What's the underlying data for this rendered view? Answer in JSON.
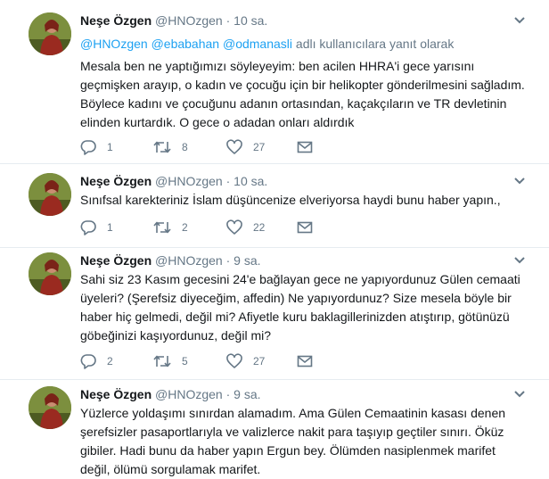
{
  "colors": {
    "link": "#1da1f2",
    "muted": "#657786",
    "text": "#14171a",
    "border": "#e6ecf0"
  },
  "tweets": [
    {
      "name": "Neşe Özgen",
      "handle": "@HNOzgen",
      "dot": "·",
      "time": "10 sa.",
      "reply_mentions": [
        "@HNOzgen",
        "@ebabahan",
        "@odmanasli"
      ],
      "reply_suffix": "adlı kullanıcılara yanıt olarak",
      "text": "Mesala ben ne yaptığımızı söyleyeyim: ben acilen HHRA'i gece yarısını geçmişken arayıp, o kadın ve çocuğu için bir helikopter gönderilmesini sağladım. Böylece kadını ve çocuğunu adanın ortasından, kaçakçıların ve TR devletinin elinden kurtardık. O gece o adadan onları aldırdık",
      "replies": "1",
      "retweets": "8",
      "likes": "27"
    },
    {
      "name": "Neşe Özgen",
      "handle": "@HNOzgen",
      "dot": "·",
      "time": "10 sa.",
      "text": "Sınıfsal karekteriniz İslam düşüncenize elveriyorsa haydi bunu haber yapın.,",
      "replies": "1",
      "retweets": "2",
      "likes": "22"
    },
    {
      "name": "Neşe Özgen",
      "handle": "@HNOzgen",
      "dot": "·",
      "time": "9 sa.",
      "text": "Sahi siz 23 Kasım gecesini 24'e bağlayan gece ne yapıyordunuz Gülen cemaati üyeleri? (Şerefsiz diyeceğim, affedin) Ne yapıyordunuz? Size mesela böyle bir haber hiç gelmedi, değil mi? Afiyetle kuru baklagillerinizden atıştırıp, götünüzü göbeğinizi kaşıyordunuz, değil mi?",
      "replies": "2",
      "retweets": "5",
      "likes": "27"
    },
    {
      "name": "Neşe Özgen",
      "handle": "@HNOzgen",
      "dot": "·",
      "time": "9 sa.",
      "text": "Yüzlerce yoldaşımı sınırdan alamadım. Ama Gülen Cemaatinin kasası denen şerefsizler pasaportlarıyla ve valizlerce nakit para taşıyıp geçtiler sınırı. Öküz gibiler. Hadi bunu da haber yapın Ergun bey. Ölümden nasiplenmek marifet değil, ölümü sorgulamak marifet."
    }
  ]
}
